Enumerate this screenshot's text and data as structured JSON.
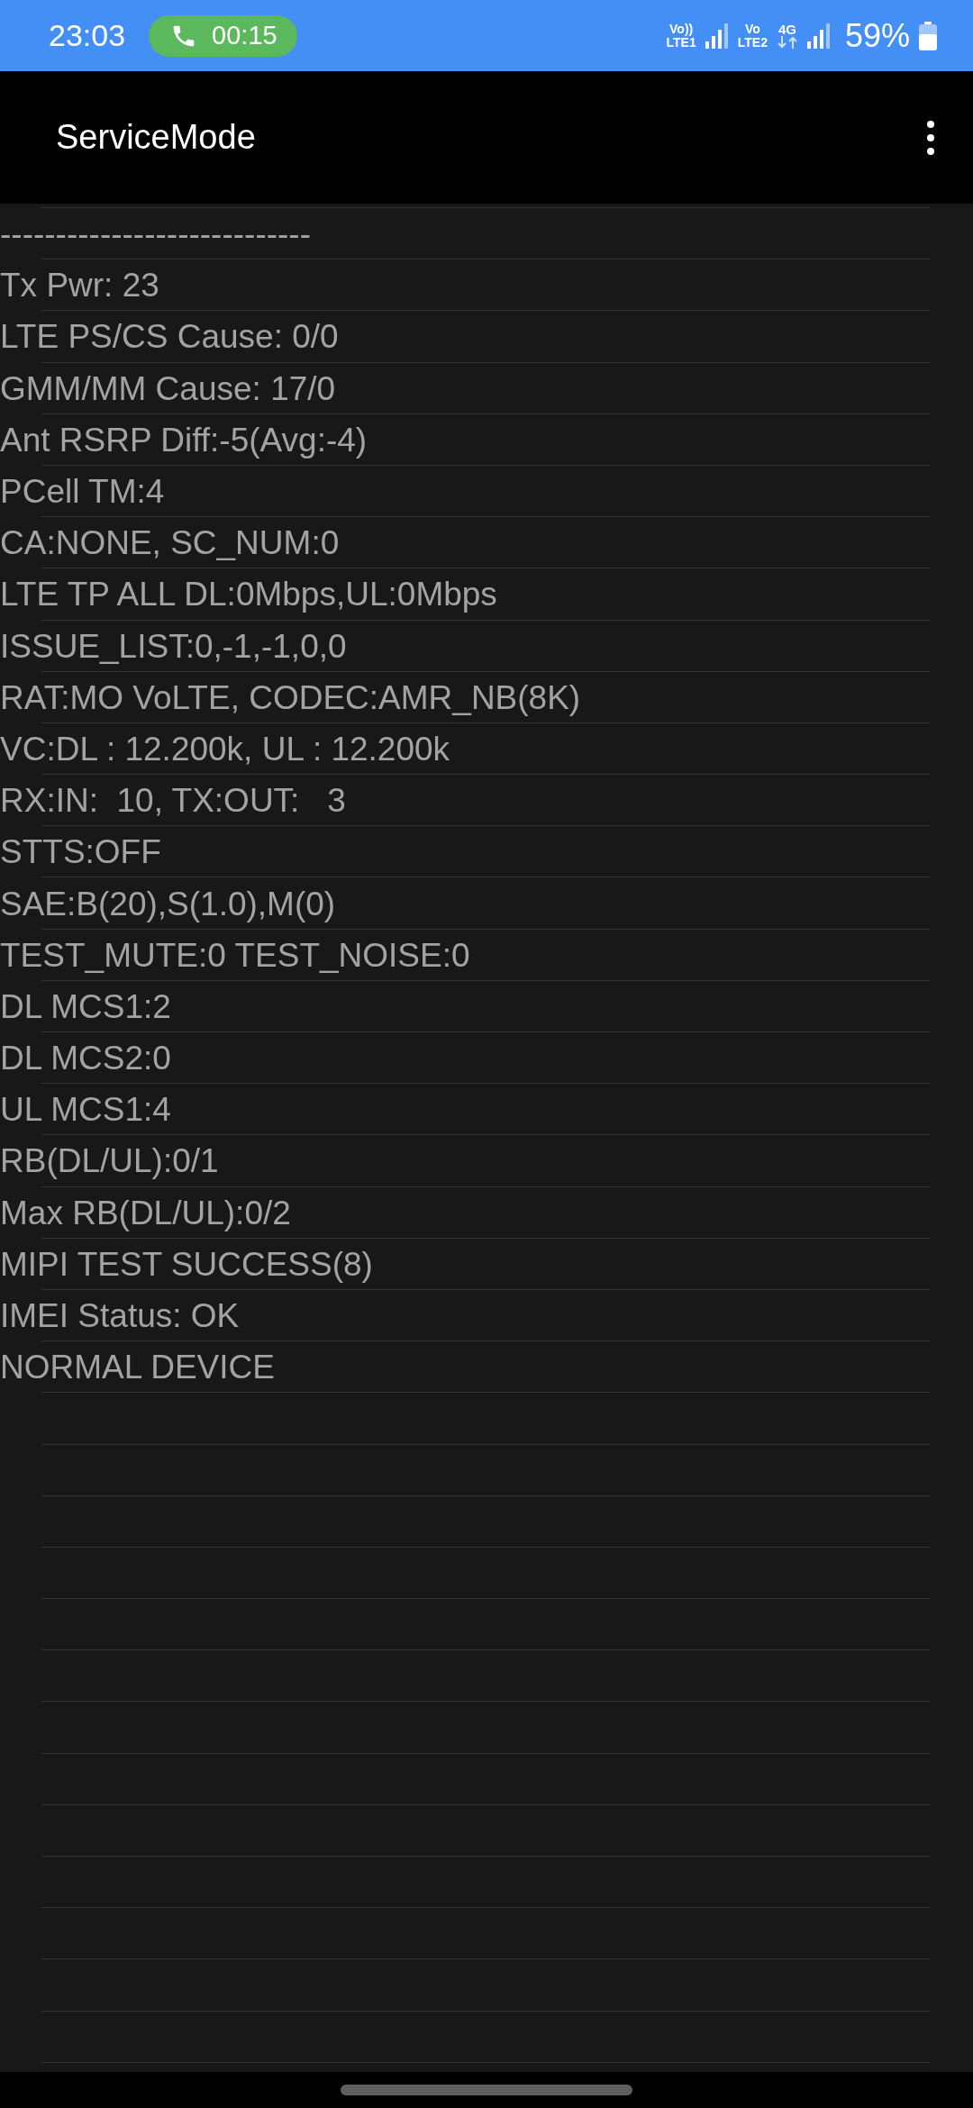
{
  "status_bar": {
    "time": "23:03",
    "call_timer": "00:15",
    "sim1": {
      "top": "Vo))",
      "bottom": "LTE1"
    },
    "sim2": {
      "top": "Vo",
      "bottom": "LTE2"
    },
    "network": "4G",
    "battery": "59%"
  },
  "app_bar": {
    "title": "ServiceMode"
  },
  "lines": [
    "----------------------------",
    "Tx Pwr: 23",
    "LTE PS/CS Cause: 0/0",
    "GMM/MM Cause: 17/0",
    "Ant RSRP Diff:-5(Avg:-4)",
    "PCell TM:4",
    "CA:NONE, SC_NUM:0",
    "LTE TP ALL DL:0Mbps,UL:0Mbps",
    "ISSUE_LIST:0,-1,-1,0,0",
    "RAT:MO VoLTE, CODEC:AMR_NB(8K)",
    "VC:DL : 12.200k, UL : 12.200k",
    "RX:IN:  10, TX:OUT:   3",
    "STTS:OFF",
    "SAE:B(20),S(1.0),M(0)",
    "TEST_MUTE:0 TEST_NOISE:0",
    "DL MCS1:2",
    "DL MCS2:0",
    "UL MCS1:4",
    "RB(DL/UL):0/1",
    "Max RB(DL/UL):0/2",
    "MIPI TEST SUCCESS(8)",
    "IMEI Status: OK",
    "NORMAL DEVICE"
  ]
}
